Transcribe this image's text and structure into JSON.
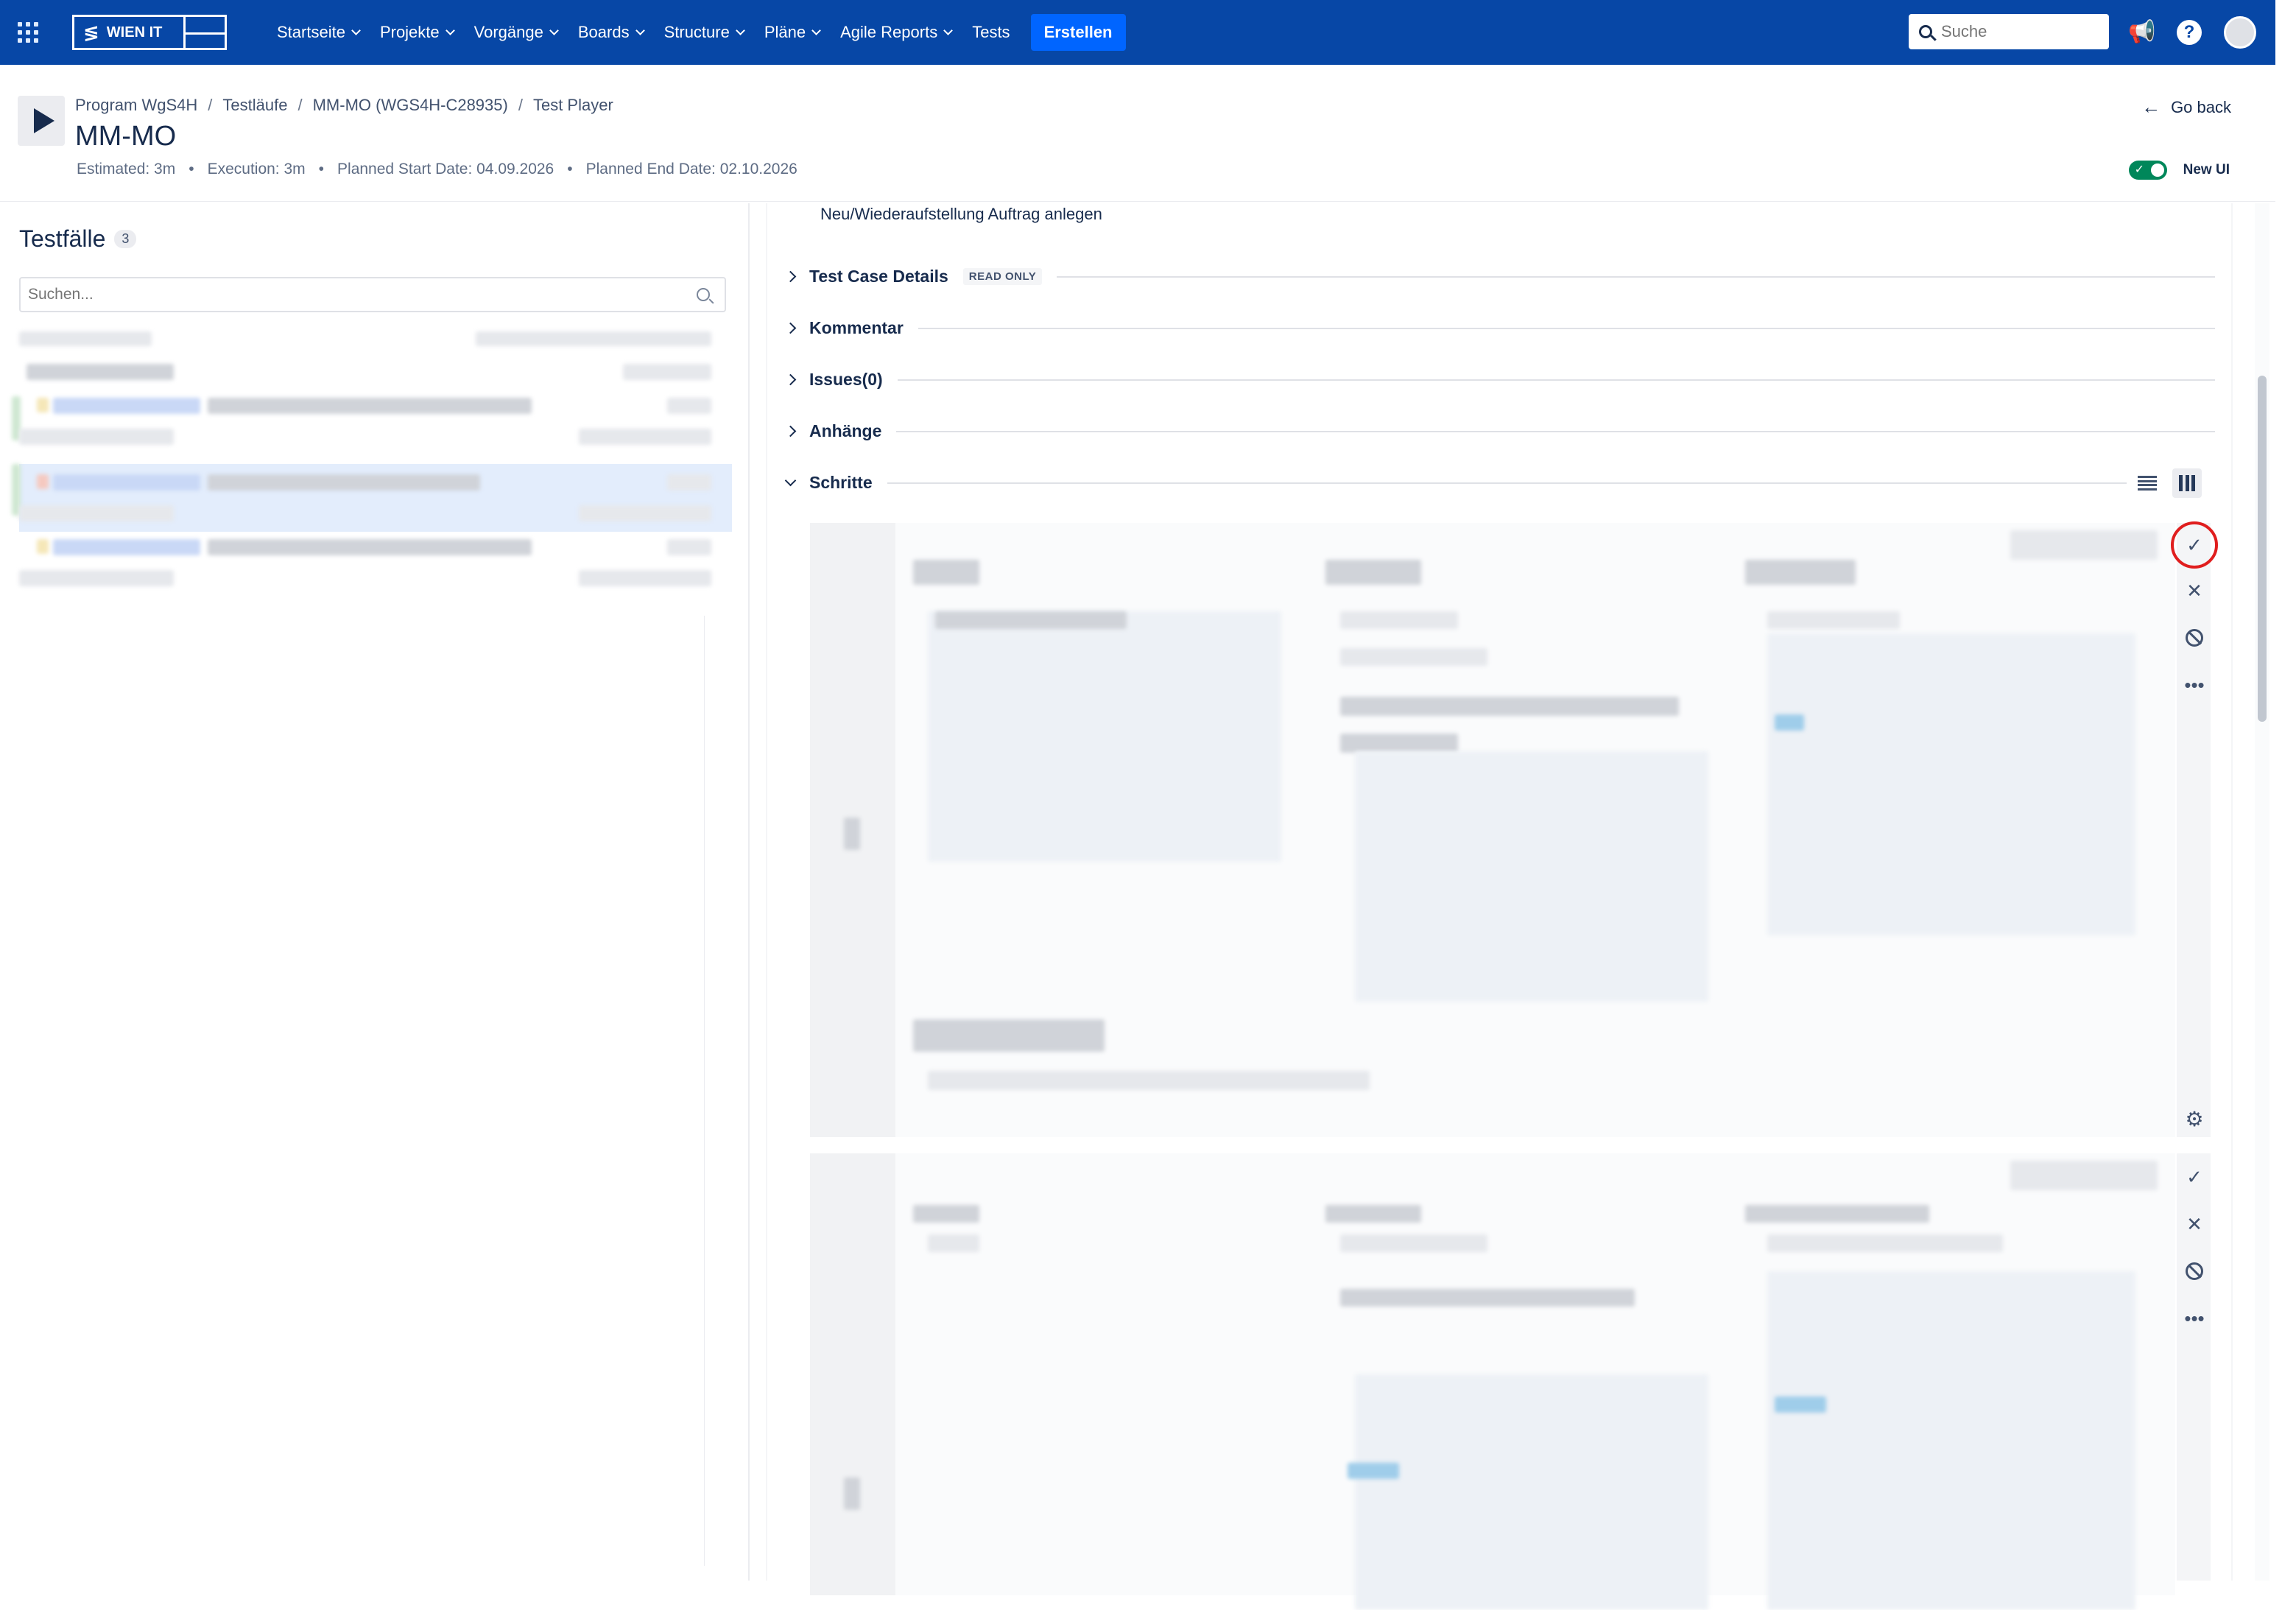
{
  "nav": {
    "logo_text": "WIEN IT",
    "menu": [
      {
        "label": "Startseite",
        "has_dropdown": true
      },
      {
        "label": "Projekte",
        "has_dropdown": true
      },
      {
        "label": "Vorgänge",
        "has_dropdown": true
      },
      {
        "label": "Boards",
        "has_dropdown": true
      },
      {
        "label": "Structure",
        "has_dropdown": true
      },
      {
        "label": "Pläne",
        "has_dropdown": true
      },
      {
        "label": "Agile Reports",
        "has_dropdown": true
      },
      {
        "label": "Tests",
        "has_dropdown": false
      }
    ],
    "create_label": "Erstellen",
    "search_placeholder": "Suche",
    "colors": {
      "nav_bg": "#0747a6",
      "create_bg": "#0065ff"
    }
  },
  "header": {
    "breadcrumb": [
      "Program WgS4H",
      "Testläufe",
      "MM-MO (WGS4H-C28935)",
      "Test Player"
    ],
    "title": "MM-MO",
    "meta": [
      "Estimated: 3m",
      "Execution: 3m",
      "Planned Start Date: 04.09.2026",
      "Planned End Date: 02.10.2026"
    ],
    "go_back": "Go back",
    "new_ui_label": "New UI",
    "new_ui_on": true
  },
  "left": {
    "title": "Testfälle",
    "count": "3",
    "search_placeholder": "Suchen..."
  },
  "right": {
    "summary": "Neu/Wiederaufstellung Auftrag anlegen",
    "sections": [
      {
        "label": "Test Case Details",
        "badge": "READ ONLY",
        "expanded": false
      },
      {
        "label": "Kommentar",
        "expanded": false
      },
      {
        "label": "Issues(0)",
        "expanded": false
      },
      {
        "label": "Anhänge",
        "expanded": false
      },
      {
        "label": "Schritte",
        "expanded": true
      }
    ]
  }
}
